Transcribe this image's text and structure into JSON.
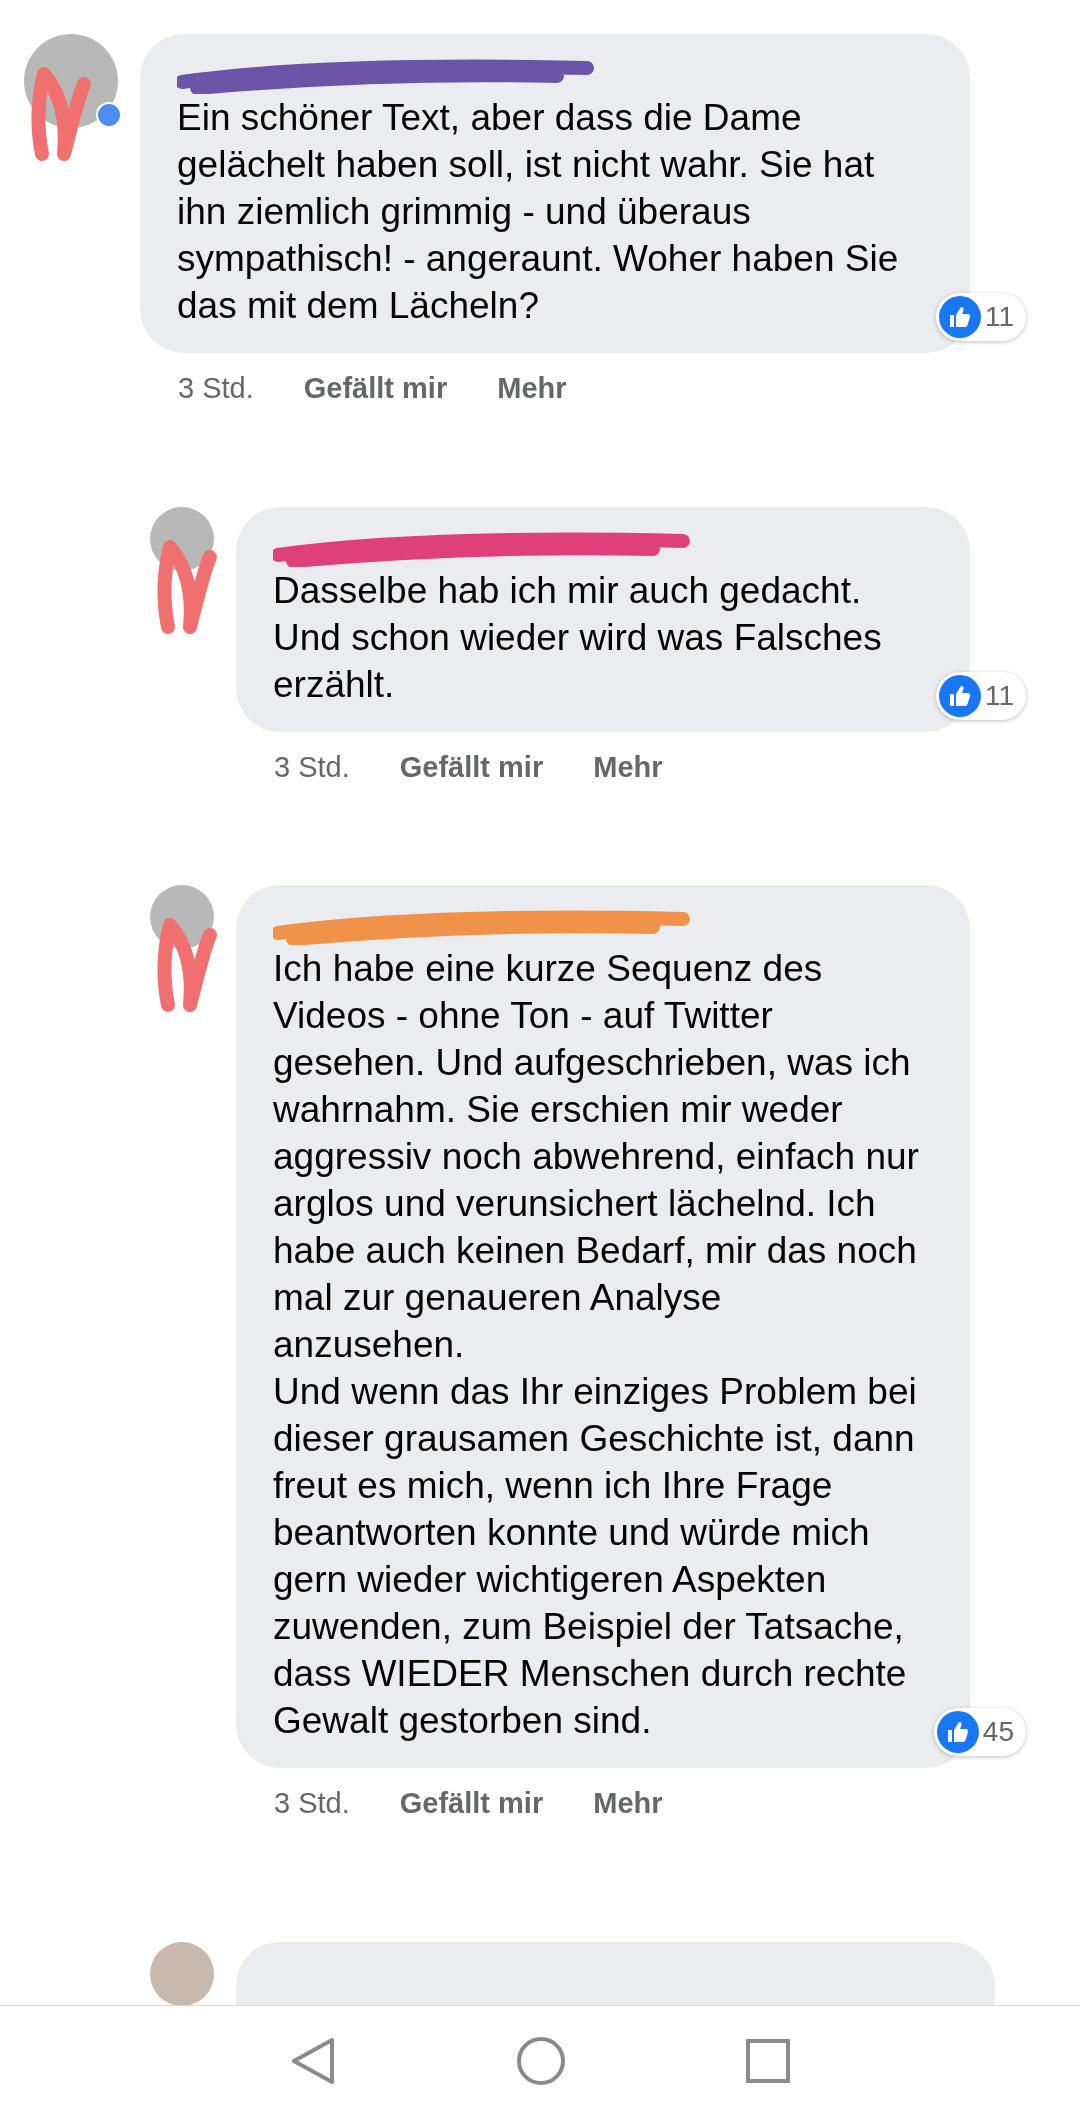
{
  "comments": [
    {
      "kind": "comment",
      "verified": true,
      "text": "Ein schöner Text, aber dass die Dame gelächelt haben soll, ist nicht wahr. Sie hat ihn ziemlich grimmig - und überaus sympathisch! - angeraunt. Woher haben Sie das mit dem Lächeln?",
      "reactions": "11",
      "time": "3 Std.",
      "like": "Gefällt mir",
      "more": "Mehr",
      "children": [
        {
          "kind": "comment",
          "verified": false,
          "text": "Dasselbe hab ich mir auch gedacht. Und schon wieder wird was Falsches erzählt.",
          "reactions": "11",
          "time": "3 Std.",
          "like": "Gefällt mir",
          "more": "Mehr"
        },
        {
          "kind": "comment",
          "verified": false,
          "text": "Ich habe eine kurze Sequenz des Videos - ohne Ton - auf Twitter gesehen. Und aufgeschrieben, was ich wahrnahm. Sie erschien mir weder aggressiv noch abwehrend, einfach nur arglos und verunsichert lächelnd. Ich habe auch keinen Bedarf, mir das noch mal zur genaueren Analyse anzusehen.\nUnd wenn das Ihr einziges Problem bei dieser grausamen Geschichte ist, dann freut es mich, wenn ich Ihre Frage beantworten konnte und würde mich gern wieder wichtigeren Aspekten zuwenden, zum Beispiel der Tatsache, dass WIEDER Menschen durch rechte Gewalt gestorben sind.",
          "reactions": "45",
          "time": "3 Std.",
          "like": "Gefällt mir",
          "more": "Mehr"
        },
        {
          "kind": "cut_off"
        }
      ]
    }
  ]
}
